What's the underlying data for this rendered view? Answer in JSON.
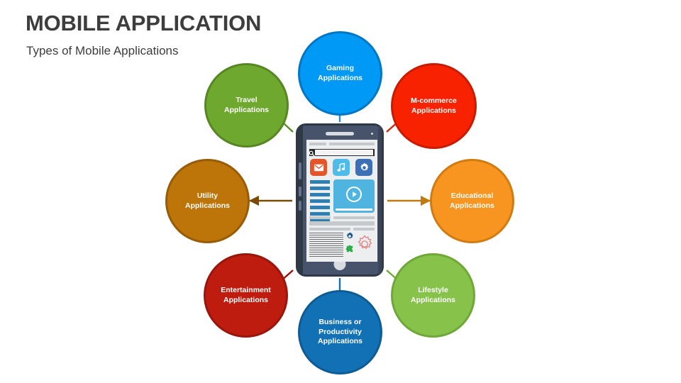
{
  "heading": {
    "title": "MOBILE APPLICATION",
    "subtitle": "Types of Mobile Applications",
    "title_color": "#3d3d3d"
  },
  "diagram": {
    "center": {
      "name": "smartphone-illustration",
      "body_color": "#46536b",
      "screen_color": "#eceeef"
    },
    "nodes": [
      {
        "id": "gaming",
        "line1": "Gaming",
        "line2": "Applications",
        "line3": "",
        "color": "#0099f5",
        "ring": "#0077c4",
        "position": "top"
      },
      {
        "id": "m-commerce",
        "line1": "M-commerce",
        "line2": "Applications",
        "line3": "",
        "color": "#f92200",
        "ring": "#c81c00",
        "position": "top-right"
      },
      {
        "id": "educational",
        "line1": "Educational",
        "line2": "Applications",
        "line3": "",
        "color": "#f79520",
        "ring": "#d07c12",
        "position": "right"
      },
      {
        "id": "lifestyle",
        "line1": "Lifestyle",
        "line2": "Applications",
        "line3": "",
        "color": "#87c34a",
        "ring": "#6fa739",
        "position": "bottom-right"
      },
      {
        "id": "business-productivity",
        "line1": "Business or",
        "line2": "Productivity",
        "line3": "Applications",
        "color": "#1271b5",
        "ring": "#0d5c95",
        "position": "bottom"
      },
      {
        "id": "entertainment",
        "line1": "Entertainment",
        "line2": "Applications",
        "line3": "",
        "color": "#bf1c10",
        "ring": "#98160b",
        "position": "bottom-left"
      },
      {
        "id": "utility",
        "line1": "Utility",
        "line2": "Applications",
        "line3": "",
        "color": "#bd7408",
        "ring": "#975c05",
        "position": "left"
      },
      {
        "id": "travel",
        "line1": "Travel",
        "line2": "Applications",
        "line3": "",
        "color": "#6fa82e",
        "ring": "#578722",
        "position": "top-left"
      }
    ],
    "connectors": [
      {
        "id": "arrow-to-gaming",
        "color": "#1f8fdb"
      },
      {
        "id": "arrow-to-m-commerce",
        "color": "#cc2a12"
      },
      {
        "id": "arrow-to-educational",
        "color": "#c07a12"
      },
      {
        "id": "arrow-to-lifestyle",
        "color": "#74a83a"
      },
      {
        "id": "arrow-to-business",
        "color": "#1271b5"
      },
      {
        "id": "arrow-to-entertainment",
        "color": "#941309"
      },
      {
        "id": "arrow-to-utility",
        "color": "#7a4b06"
      },
      {
        "id": "arrow-to-travel",
        "color": "#5d8a2b"
      }
    ]
  },
  "phone_screen": {
    "search_placeholder": "",
    "app_tiles": [
      {
        "id": "mail-tile",
        "icon": "envelope-icon",
        "color": "#e2562a"
      },
      {
        "id": "music-tile",
        "icon": "music-note-icon",
        "color": "#4fbbe8"
      },
      {
        "id": "settings-tile",
        "icon": "gear-icon",
        "color": "#3d6fb4"
      }
    ],
    "video_widget": {
      "id": "video-player",
      "icon": "play-icon",
      "color": "#4fb4e0"
    },
    "footer_icons": [
      {
        "id": "settings-gear-blue",
        "icon": "gear-icon",
        "color": "#1b4f82"
      },
      {
        "id": "settings-gear-outline",
        "icon": "gear-outline-icon",
        "color": "#e08b8b"
      },
      {
        "id": "plugin-puzzle",
        "icon": "puzzle-piece-icon",
        "color": "#2fac4a"
      }
    ]
  }
}
